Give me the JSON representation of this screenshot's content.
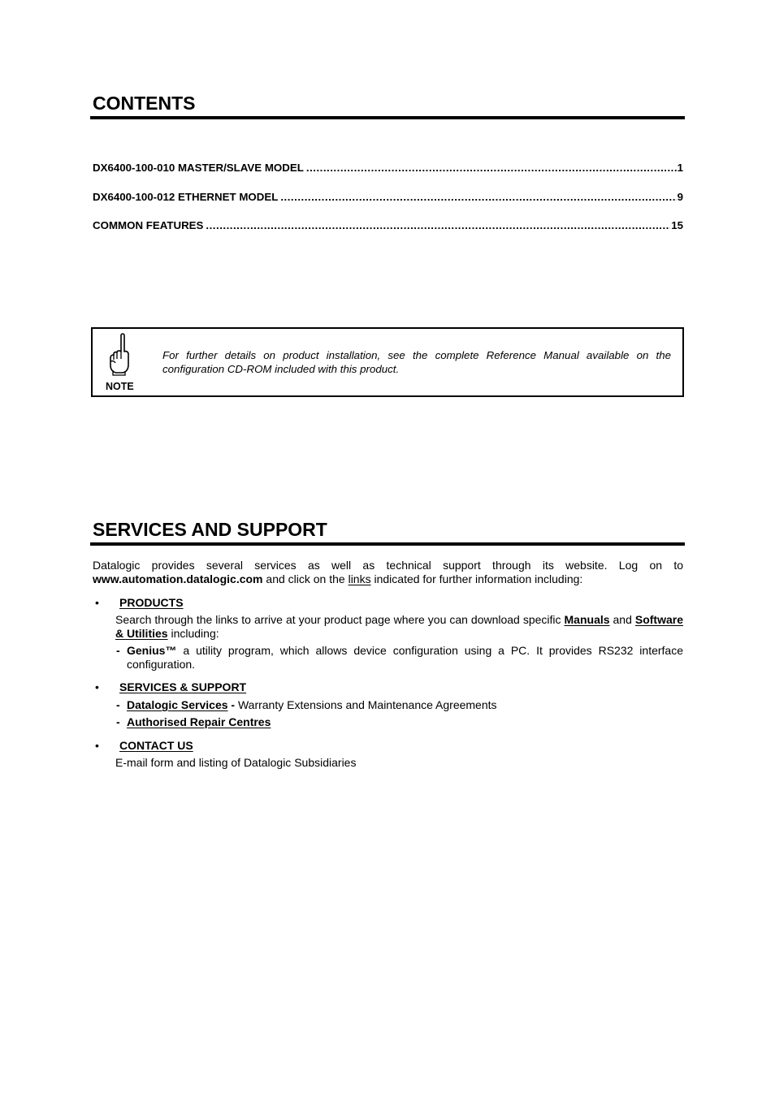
{
  "contents": {
    "title": "CONTENTS",
    "entries": [
      {
        "label": "DX6400-100-010 MASTER/SLAVE MODEL",
        "page": "1"
      },
      {
        "label": "DX6400-100-012 ETHERNET MODEL",
        "page": "9"
      },
      {
        "label": "COMMON FEATURES",
        "page": "15"
      }
    ]
  },
  "note": {
    "icon": "pointing-hand-icon",
    "label": "NOTE",
    "text": "For further details on product installation, see the complete Reference Manual available on the configuration CD-ROM included with this product."
  },
  "services": {
    "title": "SERVICES AND SUPPORT",
    "intro": {
      "part1": "Datalogic provides several services as well as technical support through its website. Log on to ",
      "website": "www.automation.datalogic.com",
      "part2": " and click on the ",
      "links_word": "links",
      "part3": " indicated for further information including:"
    },
    "bullet_glyph": "•",
    "products": {
      "heading": "PRODUCTS",
      "text1": "Search through the links to arrive at your product page where you can download specific ",
      "manuals": "Manuals",
      "text2": " and ",
      "software": "Software & Utilities",
      "text3": " including:",
      "dash": "-",
      "genius_name": "Genius™",
      "genius_text": " a utility program, which allows device configuration using a PC. It provides RS232 interface configuration."
    },
    "support": {
      "heading": "SERVICES & SUPPORT",
      "dash": "-",
      "item1_link": "Datalogic Services",
      "item1_sep": " - ",
      "item1_text": "Warranty Extensions and Maintenance Agreements",
      "item2_link": "Authorised Repair Centres"
    },
    "contact": {
      "heading": "CONTACT US",
      "text": "E-mail form and listing of Datalogic Subsidiaries"
    }
  }
}
